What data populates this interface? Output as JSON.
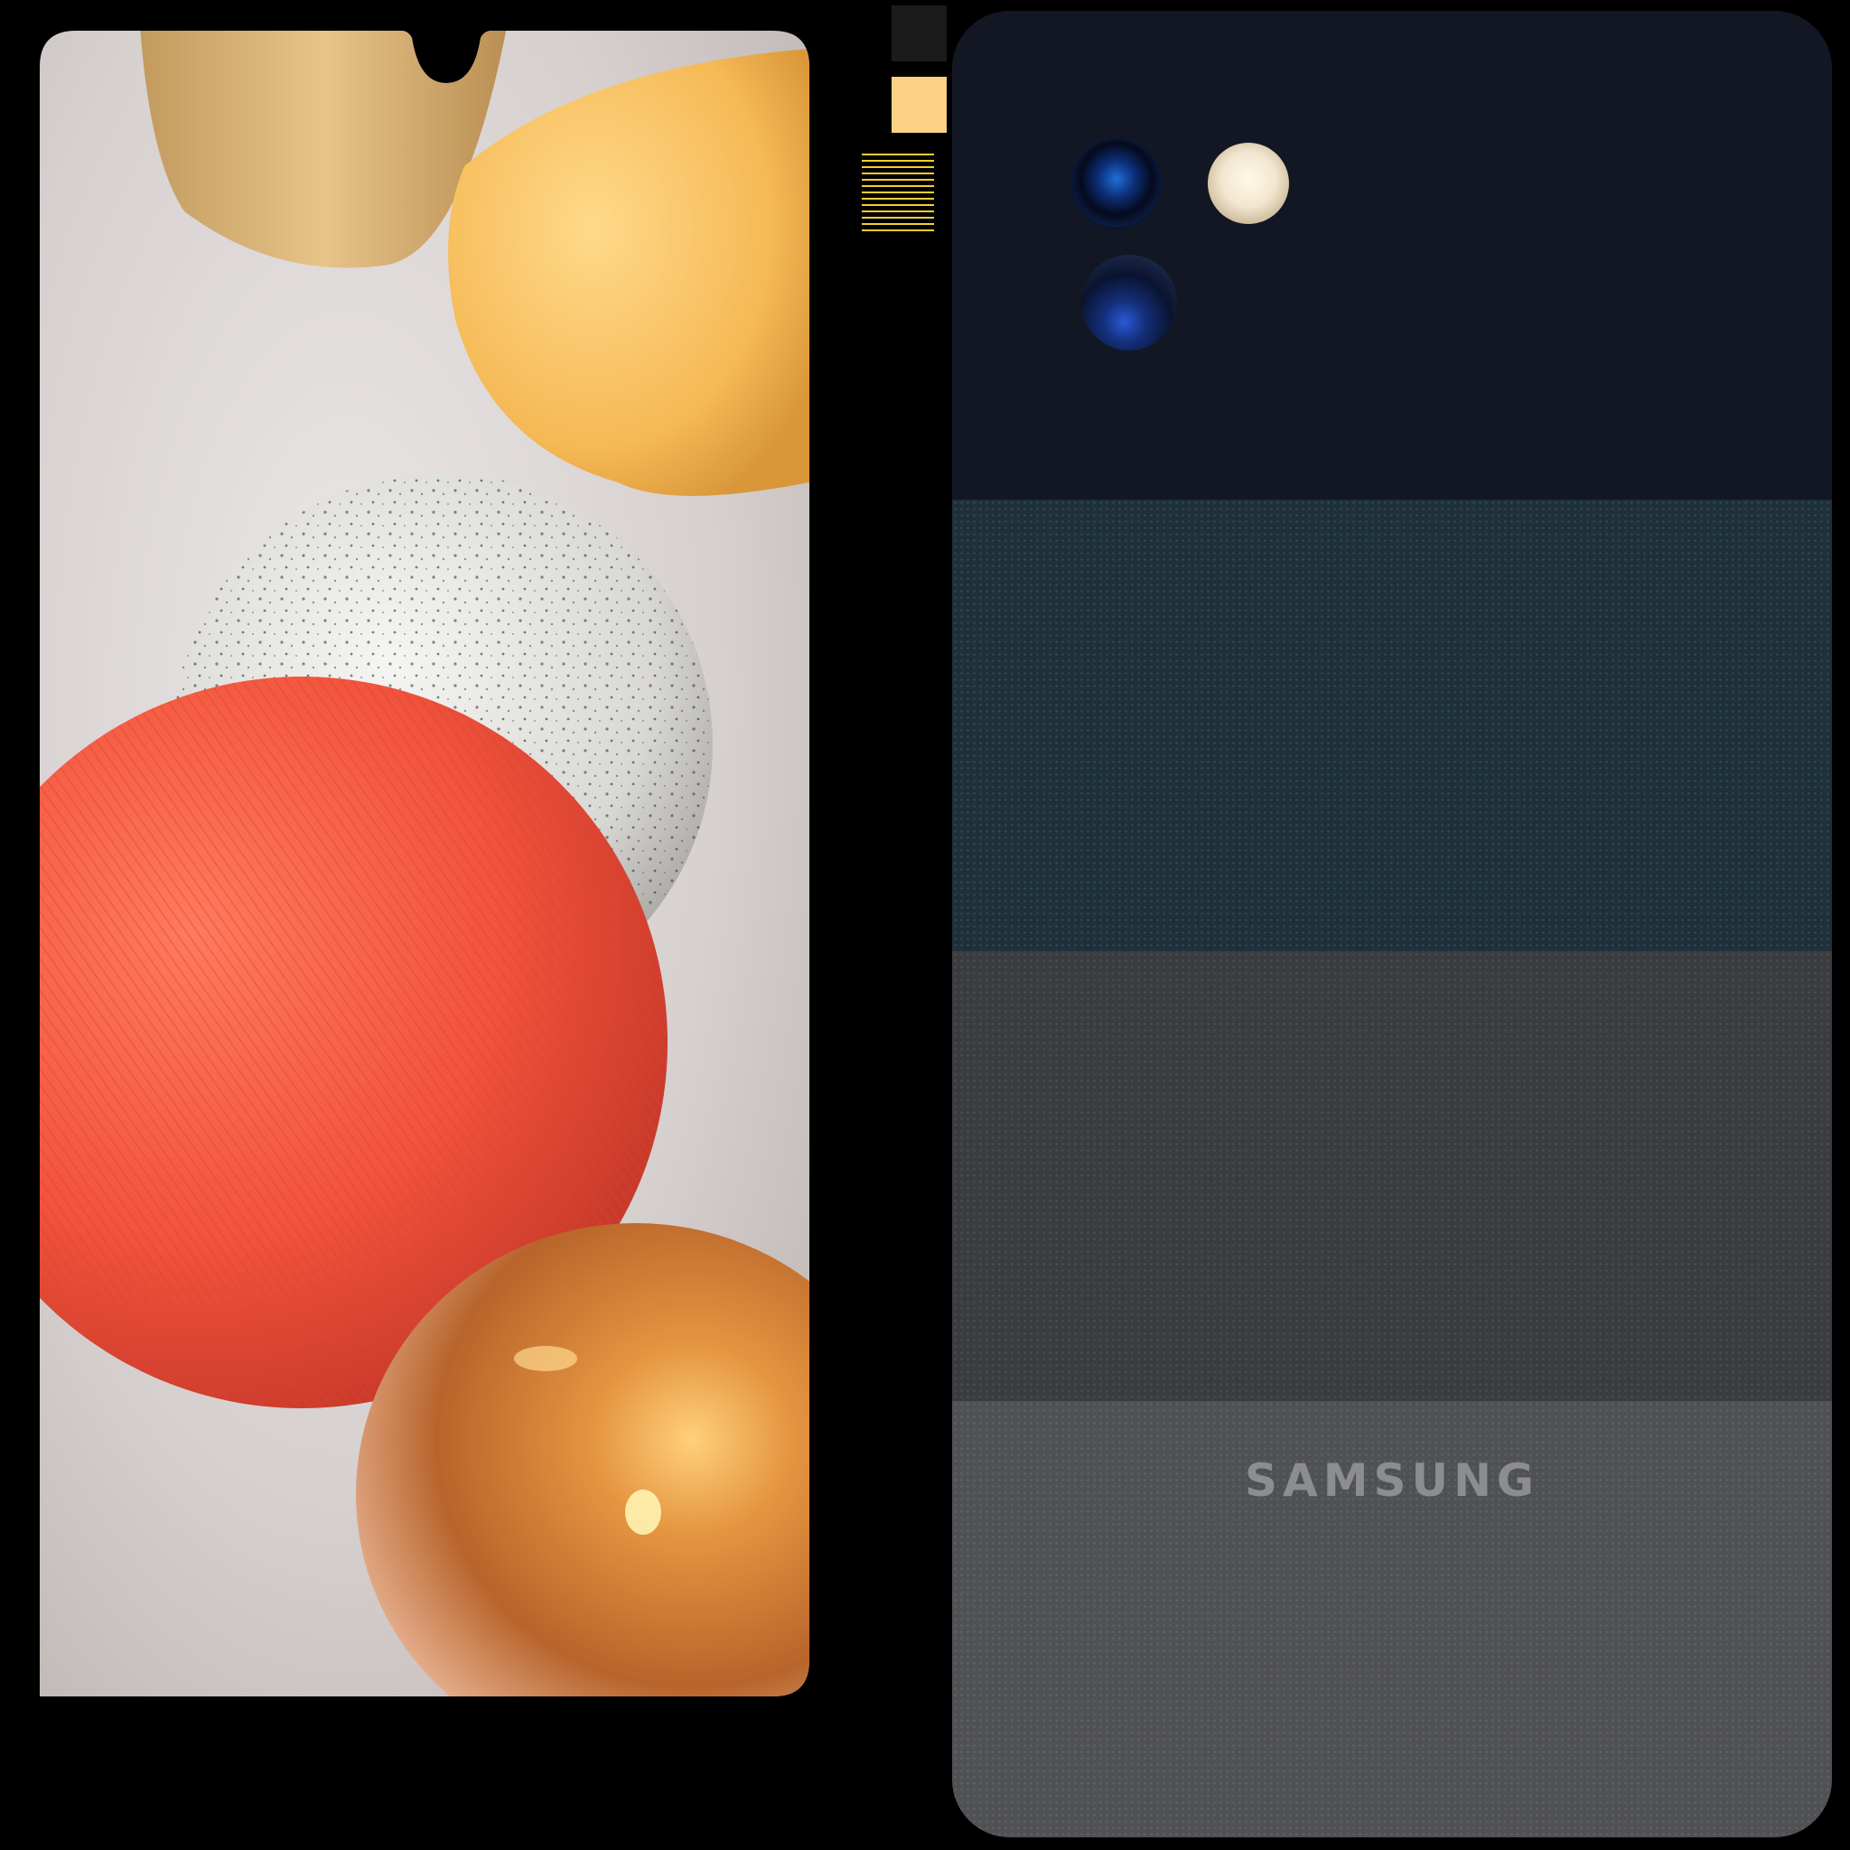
{
  "back": {
    "logo_text": "SAMSUNG"
  },
  "colors": {
    "background": "#000000",
    "swatch_dark": "#1b1b1b",
    "swatch_yellow": "#fdd185",
    "stripe_yellow": "#f7cf2b",
    "back_top": "#121723",
    "back_teal": "#1e3039",
    "back_gray": "#3b3c3f",
    "back_lightgray": "#505154",
    "sphere_red": "#f2533c",
    "sphere_yellow": "#f5b955",
    "sphere_copper": "#d98a4a",
    "fabric": "#dcd7d7"
  },
  "icons": {
    "main_camera": "camera-lens-icon",
    "flash": "flash-icon",
    "secondary_camera": "camera-lens-icon"
  }
}
